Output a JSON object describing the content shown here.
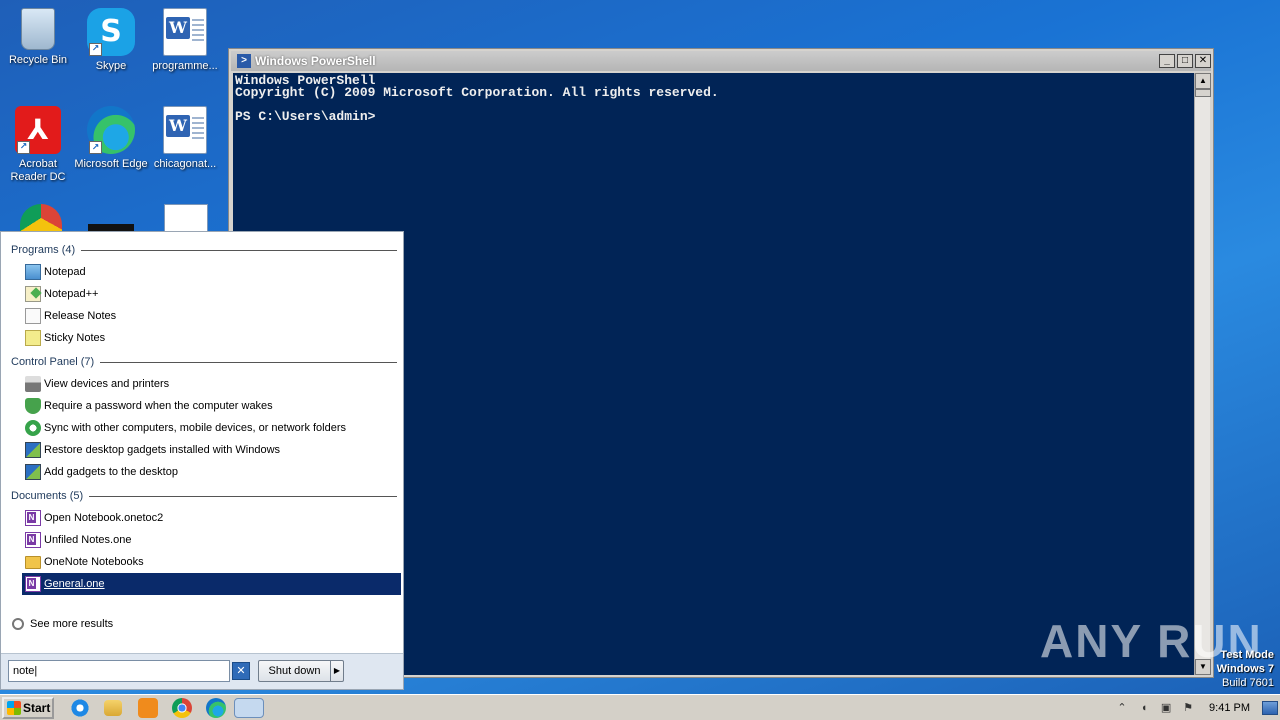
{
  "desktop": {
    "icons": [
      {
        "label": "Recycle Bin",
        "icon": "recycle-bin-icon"
      },
      {
        "label": "Skype",
        "icon": "skype-icon"
      },
      {
        "label": "programme...",
        "icon": "word-document-icon"
      },
      {
        "label": "Acrobat Reader DC",
        "icon": "acrobat-icon"
      },
      {
        "label": "Microsoft Edge",
        "icon": "edge-icon"
      },
      {
        "label": "chicagonat...",
        "icon": "word-document-icon"
      }
    ]
  },
  "powershell": {
    "title": "Windows PowerShell",
    "lines": [
      "Windows PowerShell",
      "Copyright (C) 2009 Microsoft Corporation. All rights reserved.",
      "",
      "PS C:\\Users\\admin>"
    ]
  },
  "start_menu": {
    "sections": [
      {
        "header": "Programs (4)",
        "items": [
          "Notepad",
          "Notepad++",
          "Release Notes",
          "Sticky Notes"
        ]
      },
      {
        "header": "Control Panel (7)",
        "items": [
          "View devices and printers",
          "Require a password when the computer wakes",
          "Sync with other computers, mobile devices, or network folders",
          "Restore desktop gadgets installed with Windows",
          "Add gadgets to the desktop"
        ]
      },
      {
        "header": "Documents (5)",
        "items": [
          "Open Notebook.onetoc2",
          "Unfiled Notes.one",
          "OneNote Notebooks",
          "General.one"
        ]
      }
    ],
    "selected_item": "General.one",
    "see_more": "See more results",
    "search_value": "note",
    "shutdown_label": "Shut down"
  },
  "taskbar": {
    "start_label": "Start",
    "clock": "9:41 PM",
    "apps": [
      "internet-explorer-icon",
      "file-explorer-icon",
      "media-player-icon",
      "chrome-icon",
      "edge-icon",
      "powershell-icon"
    ]
  },
  "watermark": {
    "brand": "ANY RUN",
    "test_mode": "Test Mode",
    "os": "Windows 7",
    "build": "Build 7601"
  }
}
